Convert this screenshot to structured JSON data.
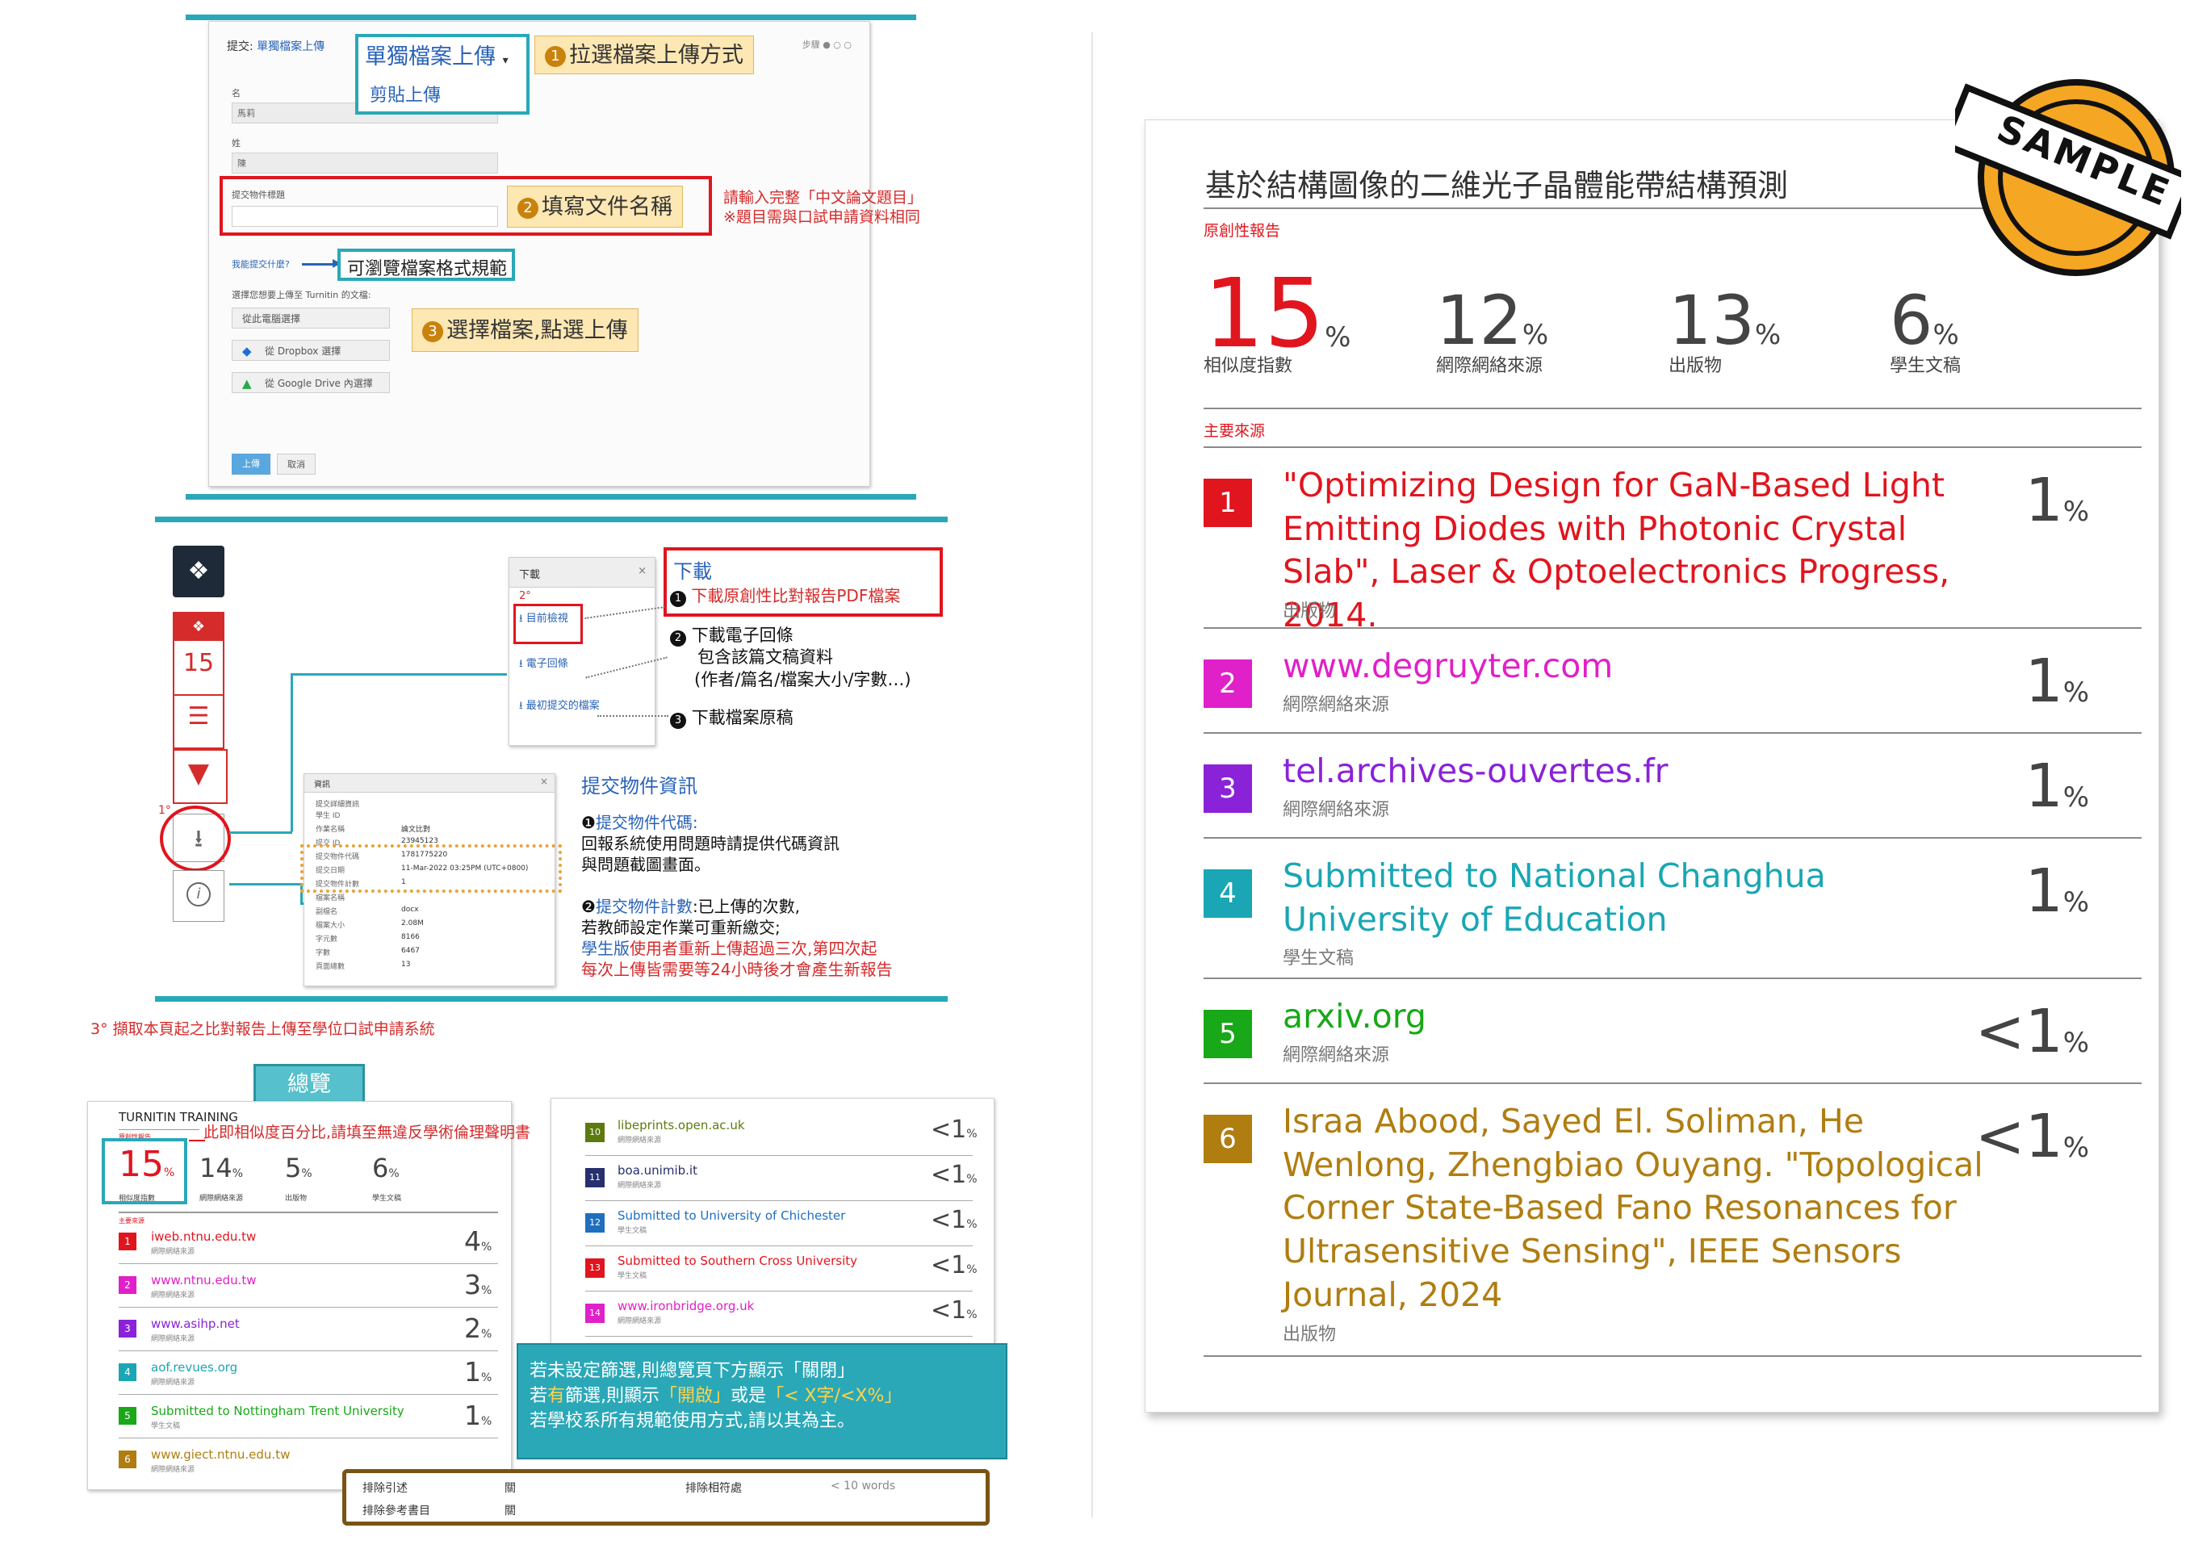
{
  "form": {
    "breadcrumb_prefix": "提交:",
    "breadcrumb_link": "單獨檔案上傳",
    "steps_label": "步驟",
    "dropdown_selected": "單獨檔案上傳",
    "dropdown_option": "剪貼上傳",
    "callout1": "拉選檔案上傳方式",
    "first_name_label": "名",
    "first_name_value": "馬莉",
    "last_name_label": "姓",
    "last_name_value": "陳",
    "title_label": "提交物件標題",
    "callout2": "填寫文件名稱",
    "note_line1": "請輸入完整「中文論文題目」",
    "note_line2": "※題目需與口試申請資料相同",
    "what_can_submit": "我能提交什麼?",
    "formats_link": "可瀏覽檔案格式規範",
    "choose_file_label": "選擇您想要上傳至 Turnitin 的文檔:",
    "from_computer": "從此電腦選擇",
    "from_dropbox": "從 Dropbox 選擇",
    "from_gdrive": "從 Google Drive 內選擇",
    "callout3": "選擇檔案,點選上傳",
    "upload_btn": "上傳",
    "cancel_btn": "取消"
  },
  "download": {
    "sidebar_score": "15",
    "marker_1": "1°",
    "marker_2": "2°",
    "panel_title": "下載",
    "item1": "目前檢視",
    "item2": "電子回條",
    "item3": "最初提交的檔案",
    "title": "下載",
    "step1": "下載原創性比對報告PDF檔案",
    "step2_l1": "下載電子回條",
    "step2_l2": "包含該篇文稿資料",
    "step2_l3": "(作者/篇名/檔案大小/字數…)",
    "step3": "下載檔案原稿",
    "info_panel_title": "資訊",
    "info_header": "提交詳細資訊",
    "info_rows": [
      {
        "k": "學生 ID",
        "v": ""
      },
      {
        "k": "作業名稱",
        "v": "論文比對"
      },
      {
        "k": "提交 ID",
        "v": "23945123"
      },
      {
        "k": "提交物件代碼",
        "v": "1781775220"
      },
      {
        "k": "提交日期",
        "v": "11-Mar-2022 03:25PM (UTC+0800)"
      },
      {
        "k": "提交物件計數",
        "v": "1"
      },
      {
        "k": "檔案名稱",
        "v": ""
      },
      {
        "k": "副檔名",
        "v": "docx"
      },
      {
        "k": "檔案大小",
        "v": "2.08M"
      },
      {
        "k": "字元數",
        "v": "8166"
      },
      {
        "k": "字數",
        "v": "6467"
      },
      {
        "k": "頁面總數",
        "v": "13"
      }
    ],
    "info_title": "提交物件資訊",
    "info_p1_head": "提交物件代碼:",
    "info_p1_l1": "回報系統使用問題時請提供代碼資訊",
    "info_p1_l2": "與問題截圖畫面。",
    "info_p2_head": "提交物件計數",
    "info_p2_tail": ":已上傳的次數,",
    "info_p2_l2": "若教師設定作業可重新繳交;",
    "info_p2_l3_blue": "學生版",
    "info_p2_l3_rest": "使用者重新上傳超過三次,第四次起",
    "info_p2_l4": "每次上傳皆需要等24小時後才會產生新報告",
    "footnote": "3° 擷取本頁起之比對報告上傳至學位口試申請系統"
  },
  "overview": {
    "tab": "總覽",
    "brand": "TURNITIN TRAINING",
    "report_small": "原創性報告",
    "note": "此即相似度百分比,請填至無違反學術倫理聲明書",
    "stats": [
      {
        "value": "15",
        "label": "相似度指數"
      },
      {
        "value": "14",
        "label": "網際網絡來源"
      },
      {
        "value": "5",
        "label": "出版物"
      },
      {
        "value": "6",
        "label": "學生文稿"
      }
    ],
    "primary_label": "主要來源",
    "left_sources": [
      {
        "num": "1",
        "title": "iweb.ntnu.edu.tw",
        "kind": "網際網絡來源",
        "pct": "4",
        "color": "#e0151e"
      },
      {
        "num": "2",
        "title": "www.ntnu.edu.tw",
        "kind": "網際網絡來源",
        "pct": "3",
        "color": "#e020c8"
      },
      {
        "num": "3",
        "title": "www.asihp.net",
        "kind": "網際網絡來源",
        "pct": "2",
        "color": "#8a22d8"
      },
      {
        "num": "4",
        "title": "aof.revues.org",
        "kind": "網際網絡來源",
        "pct": "1",
        "color": "#1aa6b4"
      },
      {
        "num": "5",
        "title": "Submitted to Nottingham Trent University",
        "kind": "學生文稿",
        "pct": "1",
        "color": "#18a818"
      },
      {
        "num": "6",
        "title": "www.giect.ntnu.edu.tw",
        "kind": "網際網絡來源",
        "pct": "",
        "color": "#b07d10"
      }
    ],
    "right_sources": [
      {
        "num": "10",
        "title": "libeprints.open.ac.uk",
        "kind": "網際網絡來源",
        "pct": "<1",
        "color": "#5d7a0e"
      },
      {
        "num": "11",
        "title": "boa.unimib.it",
        "kind": "網際網絡來源",
        "pct": "<1",
        "color": "#26306e"
      },
      {
        "num": "12",
        "title": "Submitted to University of Chichester",
        "kind": "學生文稿",
        "pct": "<1",
        "color": "#1f6fbf"
      },
      {
        "num": "13",
        "title": "Submitted to Southern Cross University",
        "kind": "學生文稿",
        "pct": "<1",
        "color": "#e0151e"
      },
      {
        "num": "14",
        "title": "www.ironbridge.org.uk",
        "kind": "網際網絡來源",
        "pct": "<1",
        "color": "#e020c8"
      }
    ],
    "filter_l1": "若未設定篩選,則總覽頁下方顯示「關閉」",
    "filter_l2a": "若",
    "filter_l2b": "有",
    "filter_l2c": "篩選,則顯示",
    "filter_l2d": "「開啟」",
    "filter_l2e": "或是",
    "filter_l2f": "「< X字/<X%」",
    "filter_l3": "若學校系所有規範使用方式,請以其為主。",
    "excl_quotes": "排除引述",
    "excl_quotes_val": "關",
    "excl_match": "排除相符處",
    "excl_match_val": "< 10 words",
    "excl_bib": "排除參考書目",
    "excl_bib_val": "關"
  },
  "report": {
    "title": "基於結構圖像的二維光子晶體能帶結構預測",
    "subtitle": "原創性報告",
    "stamp": "SAMPLE",
    "stats": [
      {
        "value": "15",
        "label": "相似度指數"
      },
      {
        "value": "12",
        "label": "網際網絡來源"
      },
      {
        "value": "13",
        "label": "出版物"
      },
      {
        "value": "6",
        "label": "學生文稿"
      }
    ],
    "primary_label": "主要來源",
    "sources": [
      {
        "num": "1",
        "title": "\"Optimizing Design for GaN-Based Light Emitting Diodes with Photonic Crystal Slab\", Laser & Optoelectronics Progress, 2014.",
        "kind": "出版物",
        "pct": "1",
        "color": "#e0151e"
      },
      {
        "num": "2",
        "title": "www.degruyter.com",
        "kind": "網際網絡來源",
        "pct": "1",
        "color": "#e020c8"
      },
      {
        "num": "3",
        "title": "tel.archives-ouvertes.fr",
        "kind": "網際網絡來源",
        "pct": "1",
        "color": "#8a22d8"
      },
      {
        "num": "4",
        "title": "Submitted to National Changhua University of Education",
        "kind": "學生文稿",
        "pct": "1",
        "color": "#1aa6b4"
      },
      {
        "num": "5",
        "title": "arxiv.org",
        "kind": "網際網絡來源",
        "pct": "<1",
        "color": "#18a818"
      },
      {
        "num": "6",
        "title": "Israa Abood, Sayed El. Soliman, He Wenlong, Zhengbiao Ouyang. \"Topological Corner State-Based Fano Resonances for Ultrasensitive Sensing\", IEEE Sensors Journal, 2024",
        "kind": "出版物",
        "pct": "<1",
        "color": "#b07d10"
      }
    ]
  }
}
